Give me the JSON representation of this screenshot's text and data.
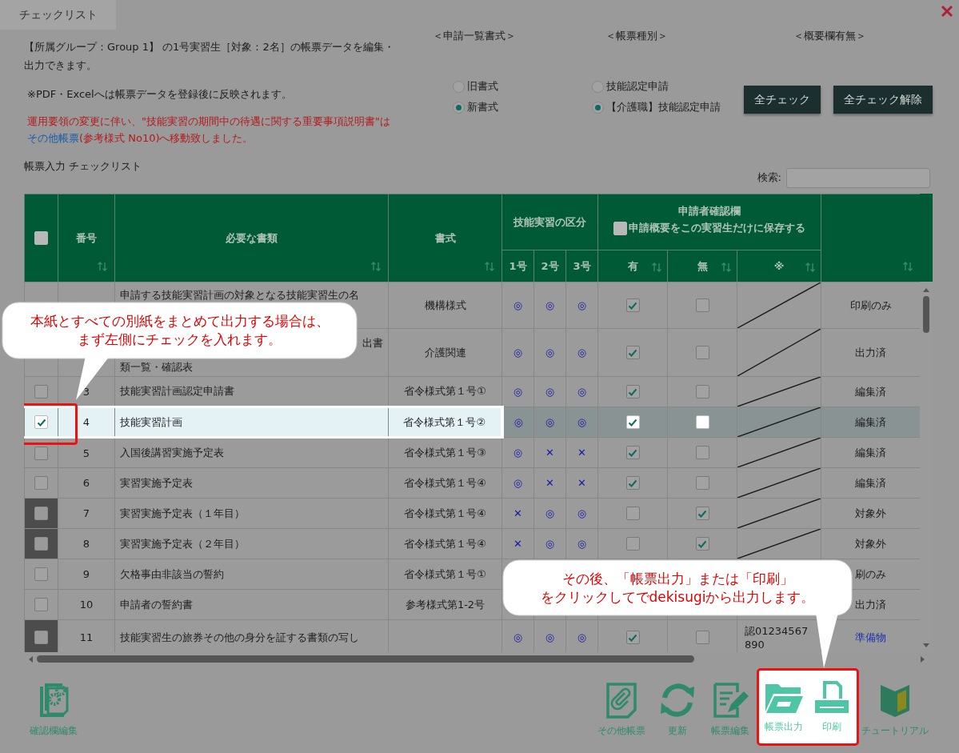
{
  "dialog": {
    "title": "チェックリスト"
  },
  "intro": {
    "summary": "【所属グループ：Group 1】 の1号実習生［対象：2名］の帳票データを編集・出力できます。",
    "note": "※PDF・Excelへは帳票データを登録後に反映されます。",
    "notice_start": "運用要領の変更に伴い、\"技能実習の期間中の待遇に関する重要事項説明書\"は",
    "notice_link": "その他帳票",
    "notice_end": "(参考様式 No10)へ移動致しました。"
  },
  "options": [
    {
      "heading": "＜申請一覧書式＞",
      "radios": [
        {
          "label": "旧書式",
          "selected": false
        },
        {
          "label": "新書式",
          "selected": true
        }
      ]
    },
    {
      "heading": "＜帳票種別＞",
      "radios": [
        {
          "label": "技能認定申請",
          "selected": false
        },
        {
          "label": "【介護職】技能認定申請",
          "selected": true
        }
      ]
    },
    {
      "heading": "＜概要欄有無＞"
    }
  ],
  "buttons": [
    "全チェック",
    "全チェック解除"
  ],
  "table_title": "帳票入力 チェックリスト",
  "search": {
    "label": "検索:"
  },
  "table": {
    "select_all": {
      "checked": false
    },
    "number": "番号",
    "name": "必要な書類",
    "form": "書式",
    "category": "技能実習の区分",
    "category_sub": [
      "1号",
      "2号",
      "3号"
    ],
    "confirm": "申請者確認欄",
    "confirm_option": {
      "label": "申請概要をこの実習生だけに保存する",
      "checked": false
    },
    "confirm_sub": [
      "有",
      "無",
      "※"
    ],
    "rows": [
      {
        "name": "申請する技能実習計画の対象となる技能実習生の名",
        "form": "機構様式",
        "category": [
          "◎",
          "◎",
          "◎"
        ],
        "present": true,
        "absent": false,
        "note": {
          "kind": "slash"
        },
        "status": {
          "text": "印刷のみ",
          "kind": "text"
        },
        "disabled": false,
        "highlighted": false
      },
      {
        "name_tail": "出書",
        "name": "類一覧・確認表",
        "form": "介護関連",
        "category": [
          "◎",
          "◎",
          "◎"
        ],
        "present": true,
        "absent": false,
        "note": {
          "kind": "slash"
        },
        "status": {
          "text": "出力済",
          "kind": "text"
        },
        "disabled": false,
        "highlighted": false
      },
      {
        "number": "3",
        "name": "技能実習計画認定申請書",
        "form": "省令様式第１号①",
        "category": [
          "◎",
          "◎",
          "◎"
        ],
        "present": true,
        "absent": false,
        "note": {
          "kind": "slash"
        },
        "status": {
          "text": "編集済",
          "kind": "text"
        },
        "checked": false,
        "disabled": false,
        "highlighted": false
      },
      {
        "number": "4",
        "name": "技能実習計画",
        "form": "省令様式第１号②",
        "category": [
          "◎",
          "◎",
          "◎"
        ],
        "present": true,
        "absent": false,
        "note": {
          "kind": "slash"
        },
        "status": {
          "text": "編集済",
          "kind": "text"
        },
        "checked": true,
        "disabled": false,
        "highlighted": true
      },
      {
        "number": "5",
        "name": "入国後講習実施予定表",
        "form": "省令様式第１号③",
        "category": [
          "◎",
          "✕",
          "✕"
        ],
        "present": true,
        "absent": false,
        "note": {
          "kind": "slash"
        },
        "status": {
          "text": "編集済",
          "kind": "text"
        },
        "checked": false,
        "disabled": false,
        "highlighted": false
      },
      {
        "number": "6",
        "name": "実習実施予定表",
        "form": "省令様式第１号④",
        "category": [
          "◎",
          "✕",
          "✕"
        ],
        "present": true,
        "absent": false,
        "note": {
          "kind": "slash"
        },
        "status": {
          "text": "編集済",
          "kind": "text"
        },
        "checked": false,
        "disabled": false,
        "highlighted": false
      },
      {
        "number": "7",
        "name": "実習実施予定表（１年目）",
        "form": "省令様式第１号④",
        "category": [
          "✕",
          "◎",
          "◎"
        ],
        "present": false,
        "absent": true,
        "note": {
          "kind": "slash"
        },
        "status": {
          "text": "対象外",
          "kind": "text"
        },
        "checked": false,
        "disabled": true,
        "highlighted": false
      },
      {
        "number": "8",
        "name": "実習実施予定表（２年目）",
        "form": "省令様式第１号④",
        "category": [
          "✕",
          "◎",
          "◎"
        ],
        "present": false,
        "absent": true,
        "note": {
          "kind": "slash"
        },
        "status": {
          "text": "対象外",
          "kind": "text"
        },
        "checked": false,
        "disabled": true,
        "highlighted": false
      },
      {
        "number": "9",
        "name": "欠格事由非該当の誓約",
        "form": "省令様式第１号①",
        "status": {
          "text": "刷のみ",
          "kind": "text"
        },
        "checked": false,
        "disabled": false,
        "highlighted": false
      },
      {
        "number": "10",
        "name": "申請者の誓約書",
        "form": "参考様式第1-2号",
        "status": {
          "text": "出力済",
          "kind": "text"
        },
        "checked": false,
        "disabled": false,
        "highlighted": false
      },
      {
        "number": "11",
        "name": "技能実習生の旅券その他の身分を証する書類の写し",
        "category": [
          "◎",
          "◎",
          "◎"
        ],
        "present": true,
        "absent": false,
        "note": {
          "kind": "text",
          "text": "認01234567890"
        },
        "status": {
          "text": "準備物",
          "kind": "link"
        },
        "checked": false,
        "disabled": true,
        "highlighted": false
      }
    ]
  },
  "toolbar": {
    "left": [
      {
        "label": "確認欄編集",
        "kind": "settings",
        "highlighted": false
      }
    ],
    "right": [
      {
        "label": "その他帳票",
        "kind": "attachment",
        "highlighted": false
      },
      {
        "label": "更新",
        "kind": "refresh",
        "highlighted": false
      },
      {
        "label": "帳票編集",
        "kind": "edit",
        "highlighted": false
      },
      {
        "label": "帳票出力",
        "kind": "folder",
        "highlighted": true
      },
      {
        "label": "印刷",
        "kind": "print",
        "highlighted": true
      },
      {
        "label": "チュートリアル",
        "kind": "guide",
        "highlighted": false
      }
    ]
  },
  "callouts": [
    {
      "lines": [
        "本紙とすべての別紙をまとめて出力する場合は、",
        "まず左側にチェックを入れます。"
      ]
    },
    {
      "lines": [
        "その後、「帳票出力」または「印刷」",
        "をクリックしてでdekisugiから出力します。"
      ]
    }
  ]
}
